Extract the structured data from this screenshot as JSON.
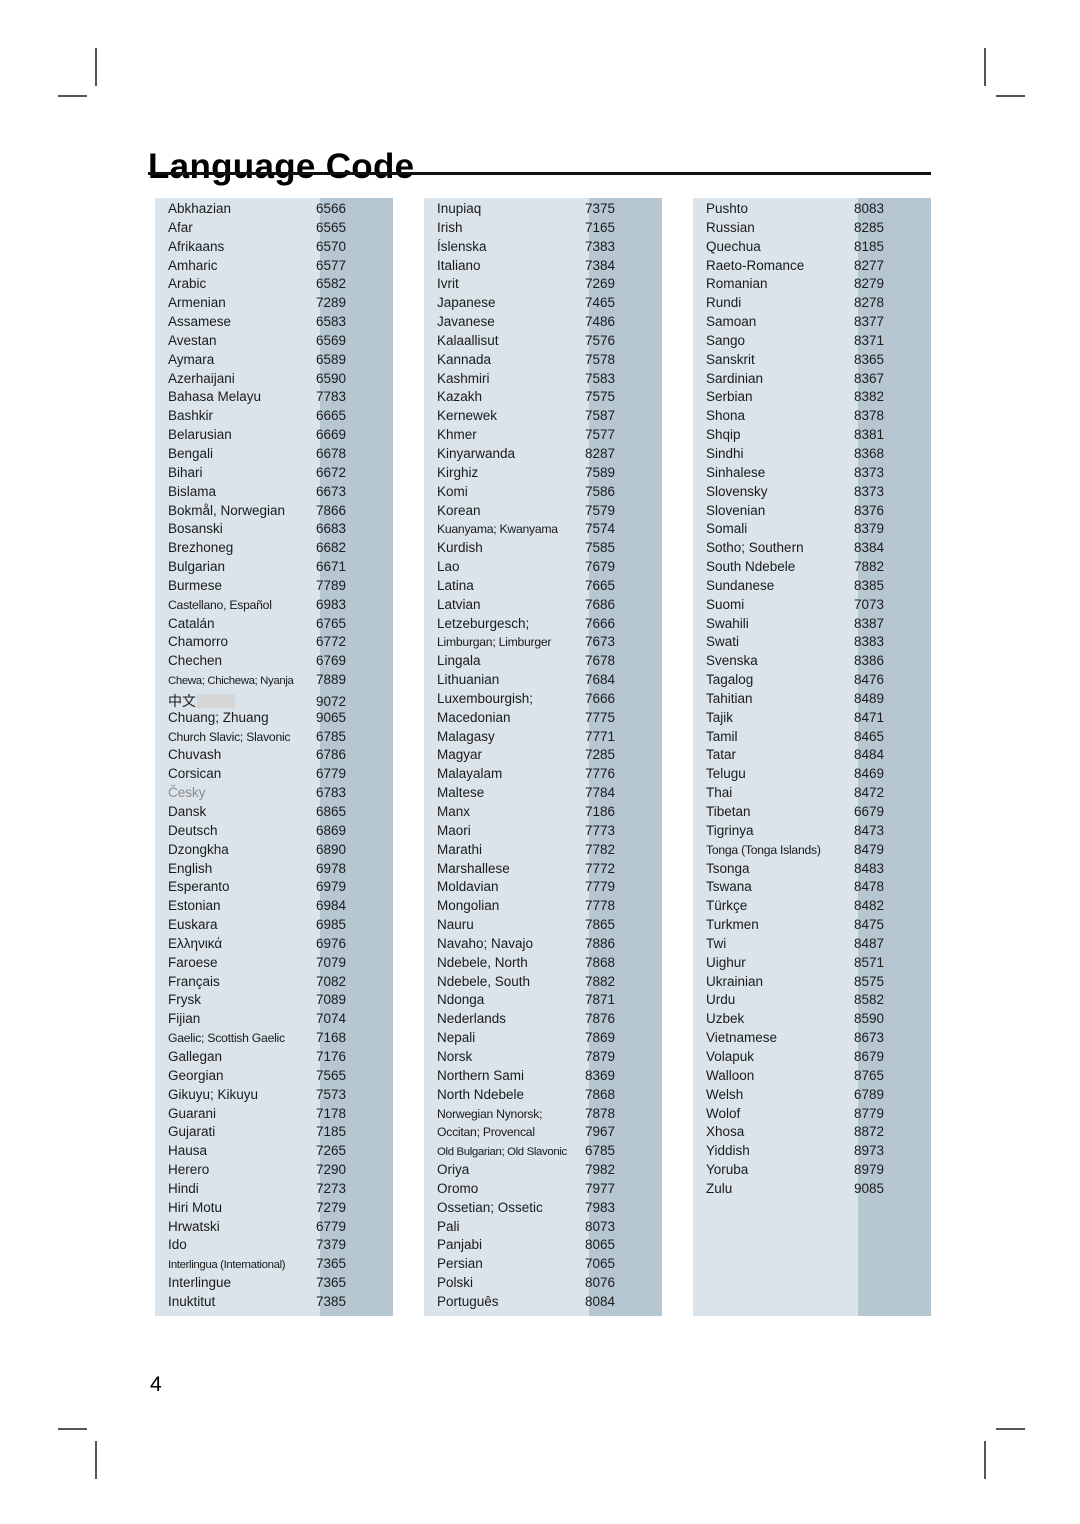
{
  "page": {
    "title": "Language Code",
    "page_number": "4"
  },
  "columns": [
    {
      "id": "column-1",
      "rows": [
        {
          "name": "Abkhazian",
          "code": "6566"
        },
        {
          "name": "Afar",
          "code": "6565"
        },
        {
          "name": "Afrikaans",
          "code": "6570"
        },
        {
          "name": "Amharic",
          "code": "6577"
        },
        {
          "name": "Arabic",
          "code": "6582"
        },
        {
          "name": "Armenian",
          "code": "7289"
        },
        {
          "name": "Assamese",
          "code": "6583"
        },
        {
          "name": "Avestan",
          "code": "6569"
        },
        {
          "name": "Aymara",
          "code": "6589"
        },
        {
          "name": "Azerhaijani",
          "code": "6590"
        },
        {
          "name": "Bahasa Melayu",
          "code": "7783"
        },
        {
          "name": "Bashkir",
          "code": "6665"
        },
        {
          "name": "Belarusian",
          "code": "6669"
        },
        {
          "name": "Bengali",
          "code": "6678"
        },
        {
          "name": "Bihari",
          "code": "6672"
        },
        {
          "name": "Bislama",
          "code": "6673"
        },
        {
          "name": "Bokmål, Norwegian",
          "code": "7866"
        },
        {
          "name": "Bosanski",
          "code": "6683"
        },
        {
          "name": "Brezhoneg",
          "code": "6682"
        },
        {
          "name": "Bulgarian",
          "code": "6671"
        },
        {
          "name": "Burmese",
          "code": "7789"
        },
        {
          "name": "Castellano, Español",
          "code": "6983",
          "style": "squeeze"
        },
        {
          "name": "Catalán",
          "code": "6765"
        },
        {
          "name": "Chamorro",
          "code": "6772"
        },
        {
          "name": "Chechen",
          "code": "6769"
        },
        {
          "name": "Chewa; Chichewa; Nyanja",
          "code": "7889",
          "style": "squeeze2"
        },
        {
          "name": "中文",
          "code": "9072",
          "style": "cjk"
        },
        {
          "name": "Chuang; Zhuang",
          "code": "9065"
        },
        {
          "name": "Church Slavic; Slavonic",
          "code": "6785",
          "style": "squeeze"
        },
        {
          "name": "Chuvash",
          "code": "6786"
        },
        {
          "name": "Corsican",
          "code": "6779"
        },
        {
          "name": "Česky",
          "code": "6783",
          "style": "faint"
        },
        {
          "name": "Dansk",
          "code": "6865"
        },
        {
          "name": "Deutsch",
          "code": "6869"
        },
        {
          "name": "Dzongkha",
          "code": "6890"
        },
        {
          "name": "English",
          "code": "6978"
        },
        {
          "name": "Esperanto",
          "code": "6979"
        },
        {
          "name": "Estonian",
          "code": "6984"
        },
        {
          "name": "Euskara",
          "code": "6985"
        },
        {
          "name": "Ελληνικά",
          "code": "6976"
        },
        {
          "name": "Faroese",
          "code": "7079"
        },
        {
          "name": "Français",
          "code": "7082"
        },
        {
          "name": "Frysk",
          "code": "7089"
        },
        {
          "name": "Fijian",
          "code": "7074"
        },
        {
          "name": "Gaelic; Scottish Gaelic",
          "code": "7168",
          "style": "squeeze"
        },
        {
          "name": "Gallegan",
          "code": "7176"
        },
        {
          "name": "Georgian",
          "code": "7565"
        },
        {
          "name": "Gikuyu; Kikuyu",
          "code": "7573"
        },
        {
          "name": "Guarani",
          "code": "7178"
        },
        {
          "name": "Gujarati",
          "code": "7185"
        },
        {
          "name": "Hausa",
          "code": "7265"
        },
        {
          "name": "Herero",
          "code": "7290"
        },
        {
          "name": "Hindi",
          "code": "7273"
        },
        {
          "name": "Hiri Motu",
          "code": "7279"
        },
        {
          "name": "Hrwatski",
          "code": "6779"
        },
        {
          "name": "Ido",
          "code": "7379"
        },
        {
          "name": "Interlingua (International)",
          "code": "7365",
          "style": "squeeze2"
        },
        {
          "name": "Interlingue",
          "code": "7365"
        },
        {
          "name": "Inuktitut",
          "code": "7385"
        }
      ]
    },
    {
      "id": "column-2",
      "rows": [
        {
          "name": "Inupiaq",
          "code": "7375"
        },
        {
          "name": "Irish",
          "code": "7165"
        },
        {
          "name": "Íslenska",
          "code": "7383"
        },
        {
          "name": "Italiano",
          "code": "7384"
        },
        {
          "name": "Ivrit",
          "code": "7269"
        },
        {
          "name": "Japanese",
          "code": "7465"
        },
        {
          "name": "Javanese",
          "code": "7486"
        },
        {
          "name": "Kalaallisut",
          "code": "7576"
        },
        {
          "name": "Kannada",
          "code": "7578"
        },
        {
          "name": "Kashmiri",
          "code": "7583"
        },
        {
          "name": "Kazakh",
          "code": "7575"
        },
        {
          "name": "Kernewek",
          "code": "7587"
        },
        {
          "name": "Khmer",
          "code": "7577"
        },
        {
          "name": "Kinyarwanda",
          "code": "8287"
        },
        {
          "name": "Kirghiz",
          "code": "7589"
        },
        {
          "name": "Komi",
          "code": "7586"
        },
        {
          "name": "Korean",
          "code": "7579"
        },
        {
          "name": "Kuanyama; Kwanyama",
          "code": "7574",
          "style": "squeeze"
        },
        {
          "name": "Kurdish",
          "code": "7585"
        },
        {
          "name": "Lao",
          "code": "7679"
        },
        {
          "name": "Latina",
          "code": "7665"
        },
        {
          "name": "Latvian",
          "code": "7686"
        },
        {
          "name": "Letzeburgesch;",
          "code": "7666"
        },
        {
          "name": "Limburgan; Limburger",
          "code": "7673",
          "style": "squeeze"
        },
        {
          "name": "Lingala",
          "code": "7678"
        },
        {
          "name": "Lithuanian",
          "code": "7684"
        },
        {
          "name": "Luxembourgish;",
          "code": "7666"
        },
        {
          "name": "Macedonian",
          "code": "7775"
        },
        {
          "name": "Malagasy",
          "code": "7771"
        },
        {
          "name": "Magyar",
          "code": "7285"
        },
        {
          "name": "Malayalam",
          "code": "7776"
        },
        {
          "name": "Maltese",
          "code": "7784"
        },
        {
          "name": "Manx",
          "code": "7186"
        },
        {
          "name": "Maori",
          "code": "7773"
        },
        {
          "name": "Marathi",
          "code": "7782"
        },
        {
          "name": "Marshallese",
          "code": "7772"
        },
        {
          "name": "Moldavian",
          "code": "7779"
        },
        {
          "name": "Mongolian",
          "code": "7778"
        },
        {
          "name": "Nauru",
          "code": "7865"
        },
        {
          "name": "Navaho; Navajo",
          "code": "7886"
        },
        {
          "name": "Ndebele, North",
          "code": "7868"
        },
        {
          "name": "Ndebele, South",
          "code": "7882"
        },
        {
          "name": "Ndonga",
          "code": "7871"
        },
        {
          "name": "Nederlands",
          "code": "7876"
        },
        {
          "name": "Nepali",
          "code": "7869"
        },
        {
          "name": "Norsk",
          "code": "7879"
        },
        {
          "name": "Northern Sami",
          "code": "8369"
        },
        {
          "name": "North Ndebele",
          "code": "7868"
        },
        {
          "name": "Norwegian Nynorsk;",
          "code": "7878",
          "style": "squeeze"
        },
        {
          "name": "Occitan; Provencal",
          "code": "7967",
          "style": "squeeze"
        },
        {
          "name": "Old Bulgarian; Old Slavonic",
          "code": "6785",
          "style": "squeeze2"
        },
        {
          "name": "Oriya",
          "code": "7982"
        },
        {
          "name": "Oromo",
          "code": "7977"
        },
        {
          "name": "Ossetian; Ossetic",
          "code": "7983"
        },
        {
          "name": "Pali",
          "code": "8073"
        },
        {
          "name": "Panjabi",
          "code": "8065"
        },
        {
          "name": "Persian",
          "code": "7065"
        },
        {
          "name": "Polski",
          "code": "8076"
        },
        {
          "name": "Português",
          "code": "8084"
        }
      ]
    },
    {
      "id": "column-3",
      "rows": [
        {
          "name": "Pushto",
          "code": "8083"
        },
        {
          "name": "Russian",
          "code": "8285"
        },
        {
          "name": "Quechua",
          "code": "8185"
        },
        {
          "name": "Raeto-Romance",
          "code": "8277"
        },
        {
          "name": "Romanian",
          "code": "8279"
        },
        {
          "name": "Rundi",
          "code": "8278"
        },
        {
          "name": "Samoan",
          "code": "8377"
        },
        {
          "name": "Sango",
          "code": "8371"
        },
        {
          "name": "Sanskrit",
          "code": "8365"
        },
        {
          "name": "Sardinian",
          "code": "8367"
        },
        {
          "name": "Serbian",
          "code": "8382"
        },
        {
          "name": "Shona",
          "code": "8378"
        },
        {
          "name": "Shqip",
          "code": "8381"
        },
        {
          "name": "Sindhi",
          "code": "8368"
        },
        {
          "name": "Sinhalese",
          "code": "8373"
        },
        {
          "name": "Slovensky",
          "code": "8373"
        },
        {
          "name": "Slovenian",
          "code": "8376"
        },
        {
          "name": "Somali",
          "code": "8379"
        },
        {
          "name": "Sotho; Southern",
          "code": "8384"
        },
        {
          "name": "South Ndebele",
          "code": "7882"
        },
        {
          "name": "Sundanese",
          "code": "8385"
        },
        {
          "name": "Suomi",
          "code": "7073"
        },
        {
          "name": "Swahili",
          "code": "8387"
        },
        {
          "name": "Swati",
          "code": "8383"
        },
        {
          "name": "Svenska",
          "code": "8386"
        },
        {
          "name": "Tagalog",
          "code": "8476"
        },
        {
          "name": "Tahitian",
          "code": "8489"
        },
        {
          "name": "Tajik",
          "code": "8471"
        },
        {
          "name": "Tamil",
          "code": "8465"
        },
        {
          "name": "Tatar",
          "code": "8484"
        },
        {
          "name": "Telugu",
          "code": "8469"
        },
        {
          "name": "Thai",
          "code": "8472"
        },
        {
          "name": "Tibetan",
          "code": "6679"
        },
        {
          "name": "Tigrinya",
          "code": "8473"
        },
        {
          "name": "Tonga (Tonga Islands)",
          "code": "8479",
          "style": "squeeze"
        },
        {
          "name": "Tsonga",
          "code": "8483"
        },
        {
          "name": "Tswana",
          "code": "8478"
        },
        {
          "name": "Türkçe",
          "code": "8482"
        },
        {
          "name": "Turkmen",
          "code": "8475"
        },
        {
          "name": "Twi",
          "code": "8487"
        },
        {
          "name": "Uighur",
          "code": "8571"
        },
        {
          "name": "Ukrainian",
          "code": "8575"
        },
        {
          "name": "Urdu",
          "code": "8582"
        },
        {
          "name": "Uzbek",
          "code": "8590"
        },
        {
          "name": "Vietnamese",
          "code": "8673"
        },
        {
          "name": "Volapuk",
          "code": "8679"
        },
        {
          "name": "Walloon",
          "code": "8765"
        },
        {
          "name": "Welsh",
          "code": "6789"
        },
        {
          "name": "Wolof",
          "code": "8779"
        },
        {
          "name": "Xhosa",
          "code": "8872"
        },
        {
          "name": "Yiddish",
          "code": "8973"
        },
        {
          "name": "Yoruba",
          "code": "8979"
        },
        {
          "name": "Zulu",
          "code": "9085"
        }
      ]
    }
  ],
  "colors": {
    "column_background": "#dbe4ea",
    "code_band_background": "#b6c7d2",
    "text": "#1b1b1b",
    "rule": "#111111",
    "crop_mark": "#555555",
    "glyph_box": "#d6d6d6"
  }
}
